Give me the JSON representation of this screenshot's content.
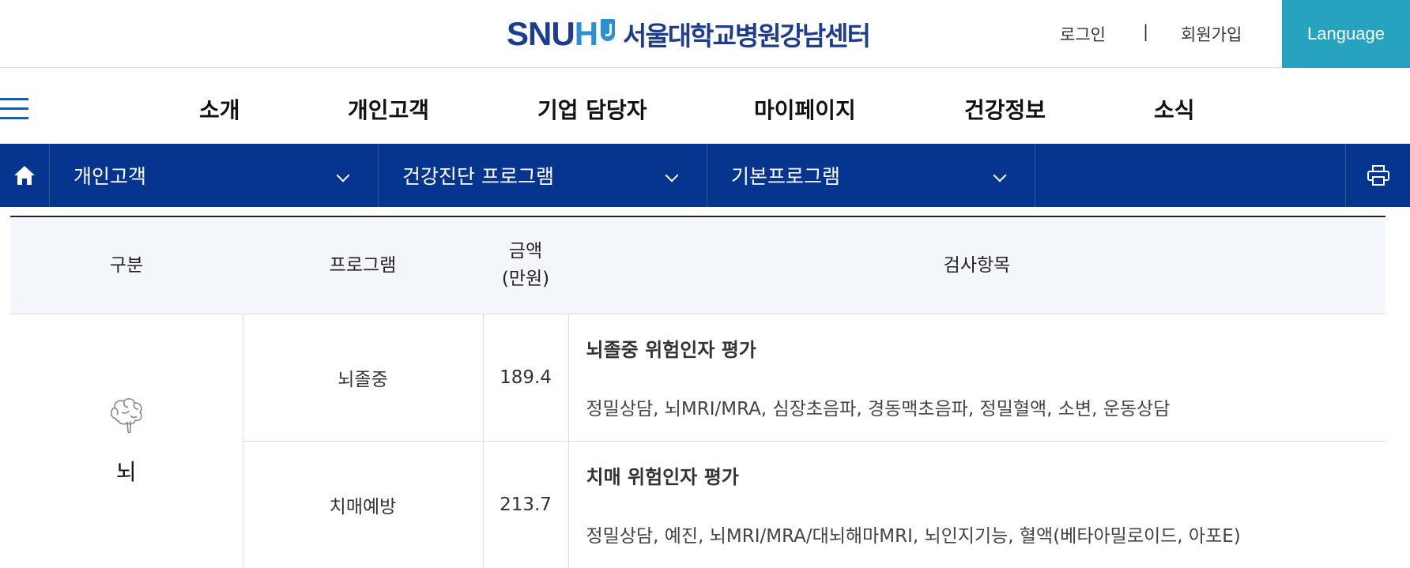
{
  "header": {
    "logo_snu": "SNU",
    "logo_h": "H",
    "logo_name": "서울대학교병원강남센터",
    "login": "로그인",
    "separator": "|",
    "join": "회원가입",
    "language": "Language"
  },
  "gnb": {
    "items": [
      "소개",
      "개인고객",
      "기업 담당자",
      "마이페이지",
      "건강정보",
      "소식"
    ]
  },
  "location": {
    "segments": [
      "개인고객",
      "건강진단 프로그램",
      "기본프로그램"
    ]
  },
  "table": {
    "headers": {
      "category": "구분",
      "program": "프로그램",
      "price_line1": "금액",
      "price_line2": "(만원)",
      "items": "검사항목"
    },
    "category": "뇌",
    "rows": [
      {
        "program": "뇌졸중",
        "price": "189.4",
        "title": "뇌졸중 위험인자 평가",
        "desc": "정밀상담, 뇌MRI/MRA, 심장초음파, 경동맥초음파, 정밀혈액, 소변, 운동상담"
      },
      {
        "program": "치매예방",
        "price": "213.7",
        "title": "치매 위험인자 평가",
        "desc": "정밀상담, 예진, 뇌MRI/MRA/대뇌해마MRI, 뇌인지기능, 혈액(베타아밀로이드, 아포E)"
      }
    ]
  },
  "colors": {
    "brand_navy": "#1d3d8f",
    "brand_blue": "#2d8fd0",
    "location_bar": "#05358f",
    "language_button": "#27a3c0"
  },
  "icons": [
    "hamburger-menu-icon",
    "home-icon",
    "chevron-down-icon",
    "print-icon",
    "brain-icon"
  ]
}
